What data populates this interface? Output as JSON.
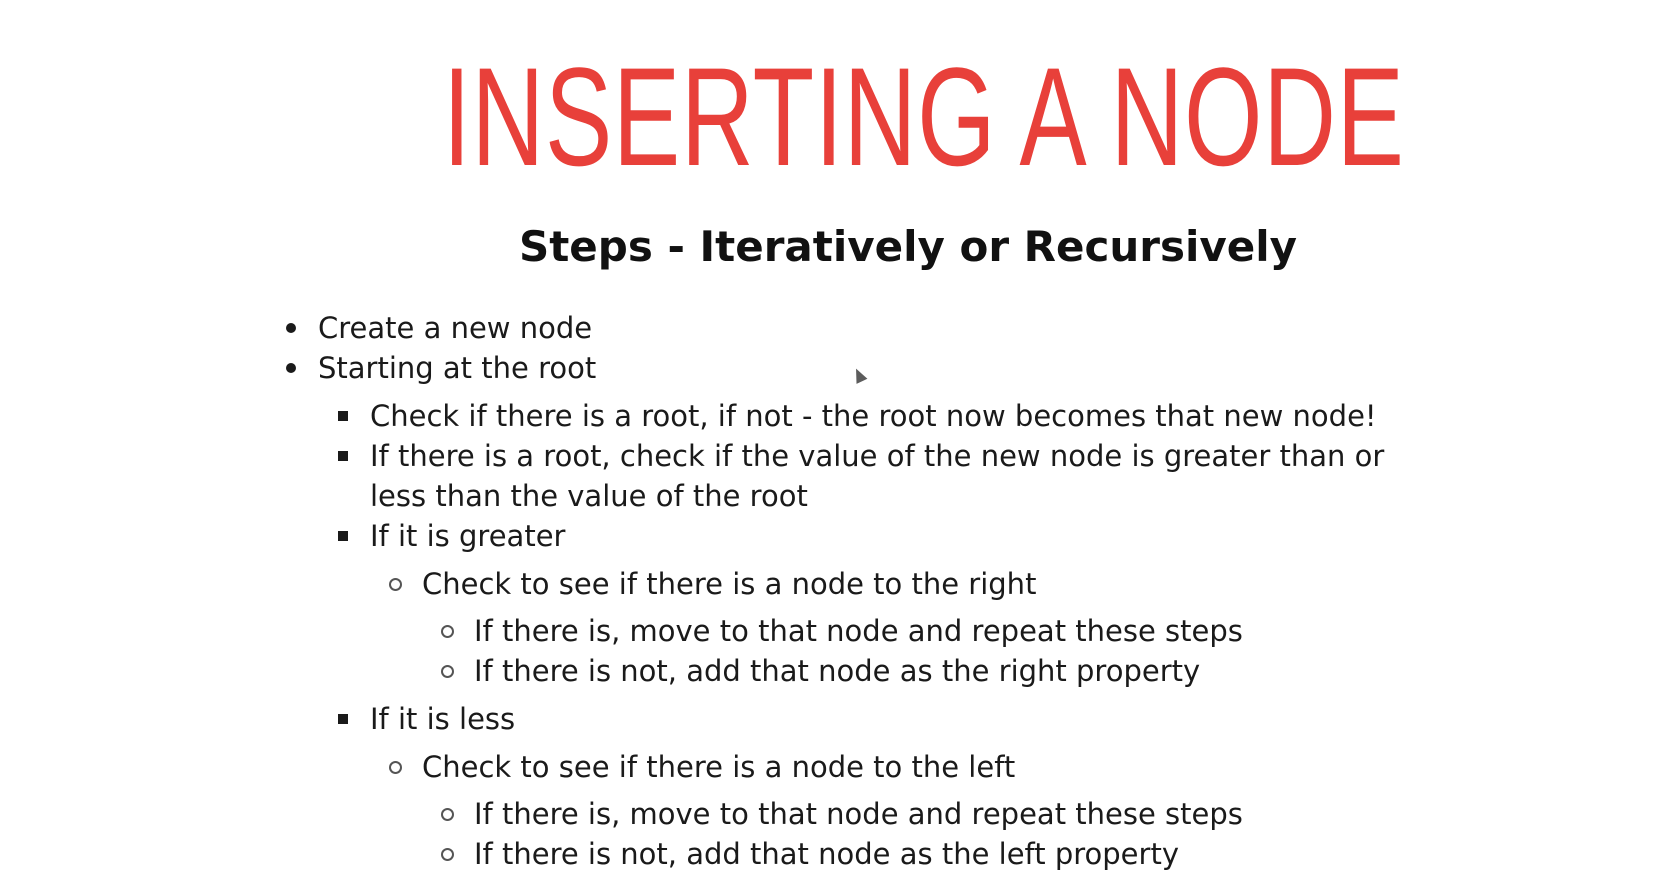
{
  "slide": {
    "title": "INSERTING A NODE",
    "subtitle": "Steps - Iteratively or Recursively",
    "items": [
      {
        "level": 1,
        "text": "Create a new node"
      },
      {
        "level": 1,
        "text": "Starting at the root"
      },
      {
        "level": 2,
        "text": "Check if there is a root, if not - the root now becomes that new node!"
      },
      {
        "level": 2,
        "text": "If there is a root, check if the value of the new node is greater than or"
      },
      {
        "level": 2,
        "text": "less than the value of the root"
      },
      {
        "level": 2,
        "text": "If it is greater"
      },
      {
        "level": 3,
        "text": "Check to see if there is a node to the right"
      },
      {
        "level": 4,
        "text": "If there is, move to that node and repeat these steps"
      },
      {
        "level": 4,
        "text": "If there is not, add that node as the right property"
      },
      {
        "level": 2,
        "text": "If it is less"
      },
      {
        "level": 3,
        "text": "Check to see if there is a node to the left"
      },
      {
        "level": 4,
        "text": "If there is, move to that node and repeat these steps"
      },
      {
        "level": 4,
        "text": "If there is not, add that node as the left property"
      }
    ]
  },
  "colors": {
    "title": "#e8403a",
    "text": "#1a1a1a",
    "background": "#ffffff"
  }
}
